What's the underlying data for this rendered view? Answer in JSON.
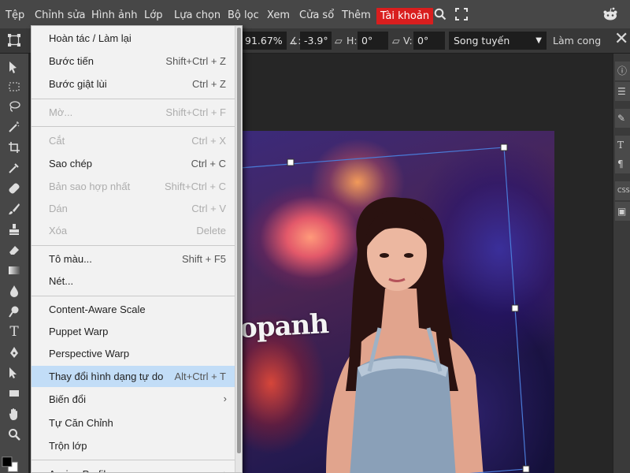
{
  "menubar": {
    "items": [
      "Tệp",
      "Chỉnh sửa",
      "Hình ảnh",
      "Lớp",
      "Lựa chọn",
      "Bộ lọc",
      "Xem",
      "Cửa sổ",
      "Thêm",
      "Tài khoản"
    ],
    "active_item": "Tài khoản",
    "active_color": "#d91e1e",
    "icons": [
      "search-icon",
      "fullscreen-icon",
      "reddit-icon"
    ]
  },
  "options": {
    "zoom": "91.67%",
    "angle": "-3.9°",
    "h_label": "H:",
    "h_value": "0°",
    "v_label": "V:",
    "v_value": "0°",
    "interpolation": "Song tuyến",
    "warp_label": "Làm cong"
  },
  "edit_menu": {
    "items": [
      {
        "label": "Hoàn tác / Làm lại",
        "shortcut": "",
        "disabled": false
      },
      {
        "label": "Bước tiến",
        "shortcut": "Shift+Ctrl + Z",
        "disabled": false
      },
      {
        "label": "Bước giật lùi",
        "shortcut": "Ctrl + Z",
        "disabled": false
      },
      {
        "label": "Mờ...",
        "shortcut": "Shift+Ctrl + F",
        "disabled": true
      },
      {
        "label": "Cắt",
        "shortcut": "Ctrl + X",
        "disabled": true
      },
      {
        "label": "Sao chép",
        "shortcut": "Ctrl + C",
        "disabled": false
      },
      {
        "label": "Bản sao hợp nhất",
        "shortcut": "Shift+Ctrl + C",
        "disabled": true
      },
      {
        "label": "Dán",
        "shortcut": "Ctrl + V",
        "disabled": true
      },
      {
        "label": "Xóa",
        "shortcut": "Delete",
        "disabled": true
      },
      {
        "label": "Tô màu...",
        "shortcut": "Shift + F5",
        "disabled": false
      },
      {
        "label": "Nét...",
        "shortcut": "",
        "disabled": false
      },
      {
        "label": "Content-Aware Scale",
        "shortcut": "",
        "disabled": false
      },
      {
        "label": "Puppet Warp",
        "shortcut": "",
        "disabled": false
      },
      {
        "label": "Perspective Warp",
        "shortcut": "",
        "disabled": false
      },
      {
        "label": "Thay đổi hình dạng tự do",
        "shortcut": "Alt+Ctrl + T",
        "disabled": false,
        "highlighted": true
      },
      {
        "label": "Biến đổi",
        "shortcut": "",
        "disabled": false,
        "submenu": true
      },
      {
        "label": "Tự Căn Chỉnh",
        "shortcut": "",
        "disabled": false
      },
      {
        "label": "Trộn lớp",
        "shortcut": "",
        "disabled": false
      },
      {
        "label": "Assign Profile...",
        "shortcut": "",
        "disabled": false,
        "submenu": true
      }
    ],
    "highlight_color": "#c2ddf7"
  },
  "canvas": {
    "overlay_text": "opanh"
  },
  "right_panel": {
    "buttons": [
      "info-icon",
      "list-icon",
      "brush-settings-icon",
      "text-icon",
      "paragraph-icon",
      "css-label",
      "image-icon"
    ],
    "css_label": "CSS",
    "close_icon": "close-icon"
  },
  "toolbar": {
    "tools": [
      "move-tool",
      "marquee-tool",
      "lasso-tool",
      "magic-wand-tool",
      "crop-tool",
      "eyedropper-tool",
      "healing-tool",
      "brush-tool",
      "stamp-tool",
      "eraser-tool",
      "gradient-tool",
      "blur-tool",
      "dodge-tool",
      "type-tool",
      "pen-tool",
      "path-select-tool",
      "shape-tool",
      "hand-tool",
      "zoom-tool",
      "color-swatch"
    ]
  }
}
